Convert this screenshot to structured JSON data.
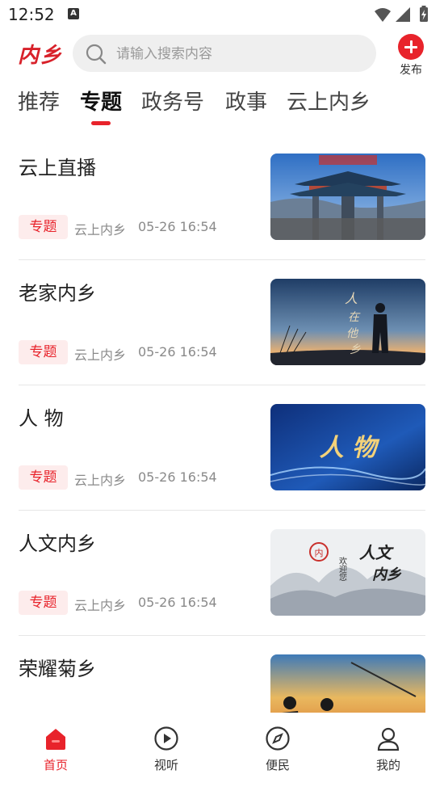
{
  "status_bar": {
    "time": "12:52",
    "notification_badge": "A"
  },
  "header": {
    "logo": "内乡",
    "search": {
      "placeholder": "请输入搜索内容"
    },
    "publish_label": "发布"
  },
  "tabs": [
    {
      "label": "推荐"
    },
    {
      "label": "专题",
      "active": true
    },
    {
      "label": "政务号"
    },
    {
      "label": "政事"
    },
    {
      "label": "云上内乡"
    }
  ],
  "news": [
    {
      "title": "云上直播",
      "tag": "专题",
      "source": "云上内乡",
      "time": "05-26 16:54",
      "thumb": "gate-archway-image"
    },
    {
      "title": "老家内乡",
      "tag": "专题",
      "source": "云上内乡",
      "time": "05-26 16:54",
      "thumb": "sunset-silhouette-image"
    },
    {
      "title": "人 物",
      "tag": "专题",
      "source": "云上内乡",
      "time": "05-26 16:54",
      "thumb": "blue-calligraphy-image",
      "thumb_text": "人 物"
    },
    {
      "title": "人文内乡",
      "tag": "专题",
      "source": "云上内乡",
      "time": "05-26 16:54",
      "thumb": "ink-mountain-image",
      "thumb_text": "欢迎您"
    },
    {
      "title": "荣耀菊乡",
      "thumb": "sunset-crane-image"
    }
  ],
  "bottom_nav": [
    {
      "label": "首页",
      "icon": "home-icon",
      "active": true
    },
    {
      "label": "视听",
      "icon": "play-icon"
    },
    {
      "label": "便民",
      "icon": "compass-icon"
    },
    {
      "label": "我的",
      "icon": "profile-icon"
    }
  ],
  "colors": {
    "accent": "#e8232b",
    "tag_bg": "#fdecec",
    "search_bg": "#efefef"
  }
}
